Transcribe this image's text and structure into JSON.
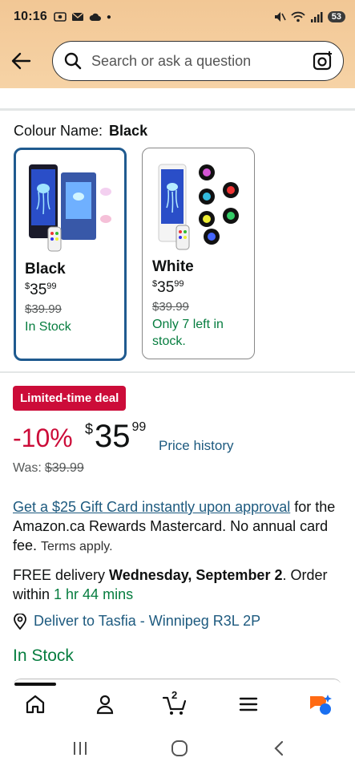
{
  "status_bar": {
    "time": "10:16",
    "battery": "53"
  },
  "search": {
    "placeholder": "Search or ask a question"
  },
  "colour": {
    "label": "Colour Name:",
    "selected": "Black"
  },
  "swatches": [
    {
      "name": "Black",
      "currency": "$",
      "whole": "35",
      "cents": "99",
      "was": "$39.99",
      "stock": "In Stock"
    },
    {
      "name": "White",
      "currency": "$",
      "whole": "35",
      "cents": "99",
      "was": "$39.99",
      "stock": "Only 7 left in stock."
    }
  ],
  "deal": {
    "badge": "Limited-time deal",
    "discount": "-10%",
    "currency": "$",
    "whole": "35",
    "cents": "99",
    "price_history": "Price history",
    "was_label": "Was:",
    "was_price": "$39.99"
  },
  "promo": {
    "link": "Get a $25 Gift Card instantly upon approval",
    "text": " for the Amazon.ca Rewards Mastercard. No annual card fee. ",
    "terms": "Terms apply."
  },
  "delivery": {
    "prefix": "FREE delivery ",
    "date": "Wednesday, September 2",
    "mid": ". Order within ",
    "countdown": "1 hr 44 mins"
  },
  "deliver_to": "Deliver to Tasfia - Winnipeg R3L 2P",
  "in_stock": "In Stock",
  "bottom_nav": {
    "cart_count": "2"
  },
  "colors": {
    "accent_link": "#1d5a7f",
    "deal_red": "#cc0c39",
    "stock_green": "#067d3f",
    "selected_border": "#1f5a8f"
  }
}
